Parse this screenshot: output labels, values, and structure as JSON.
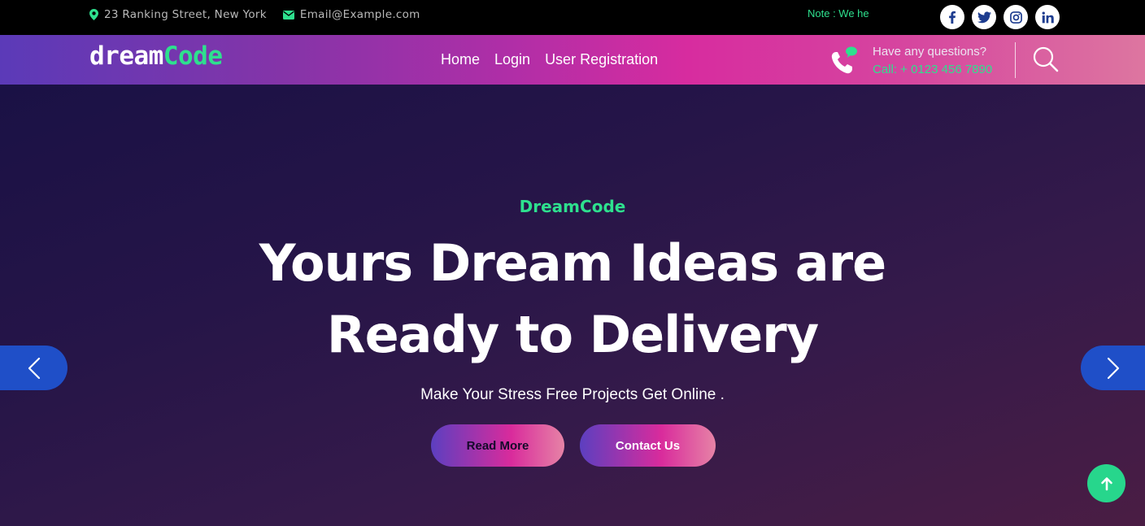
{
  "topbar": {
    "address": "23 Ranking Street, New York",
    "email": "Email@Example.com",
    "note": "Note : We he",
    "social": [
      "facebook-icon",
      "twitter-icon",
      "instagram-icon",
      "linkedin-icon"
    ]
  },
  "nav": {
    "logo_main": "dream",
    "logo_accent": "Code",
    "links": [
      "Home",
      "Login",
      "User Registration"
    ],
    "phone_question": "Have any questions?",
    "phone_call": "Call: + 0123 456 7890"
  },
  "hero": {
    "eyebrow": "DreamCode",
    "title_line1": "Yours Dream Ideas are",
    "title_line2": "Ready to Delivery",
    "subtitle": "Make Your Stress Free Projects Get Online .",
    "read_more": "Read More",
    "contact_us": "Contact Us"
  },
  "colors": {
    "accent_green": "#2ee08e",
    "slider_arrow_blue": "#1f4fc8",
    "topbar_bg": "#000000",
    "hero_bg": "#261548"
  }
}
